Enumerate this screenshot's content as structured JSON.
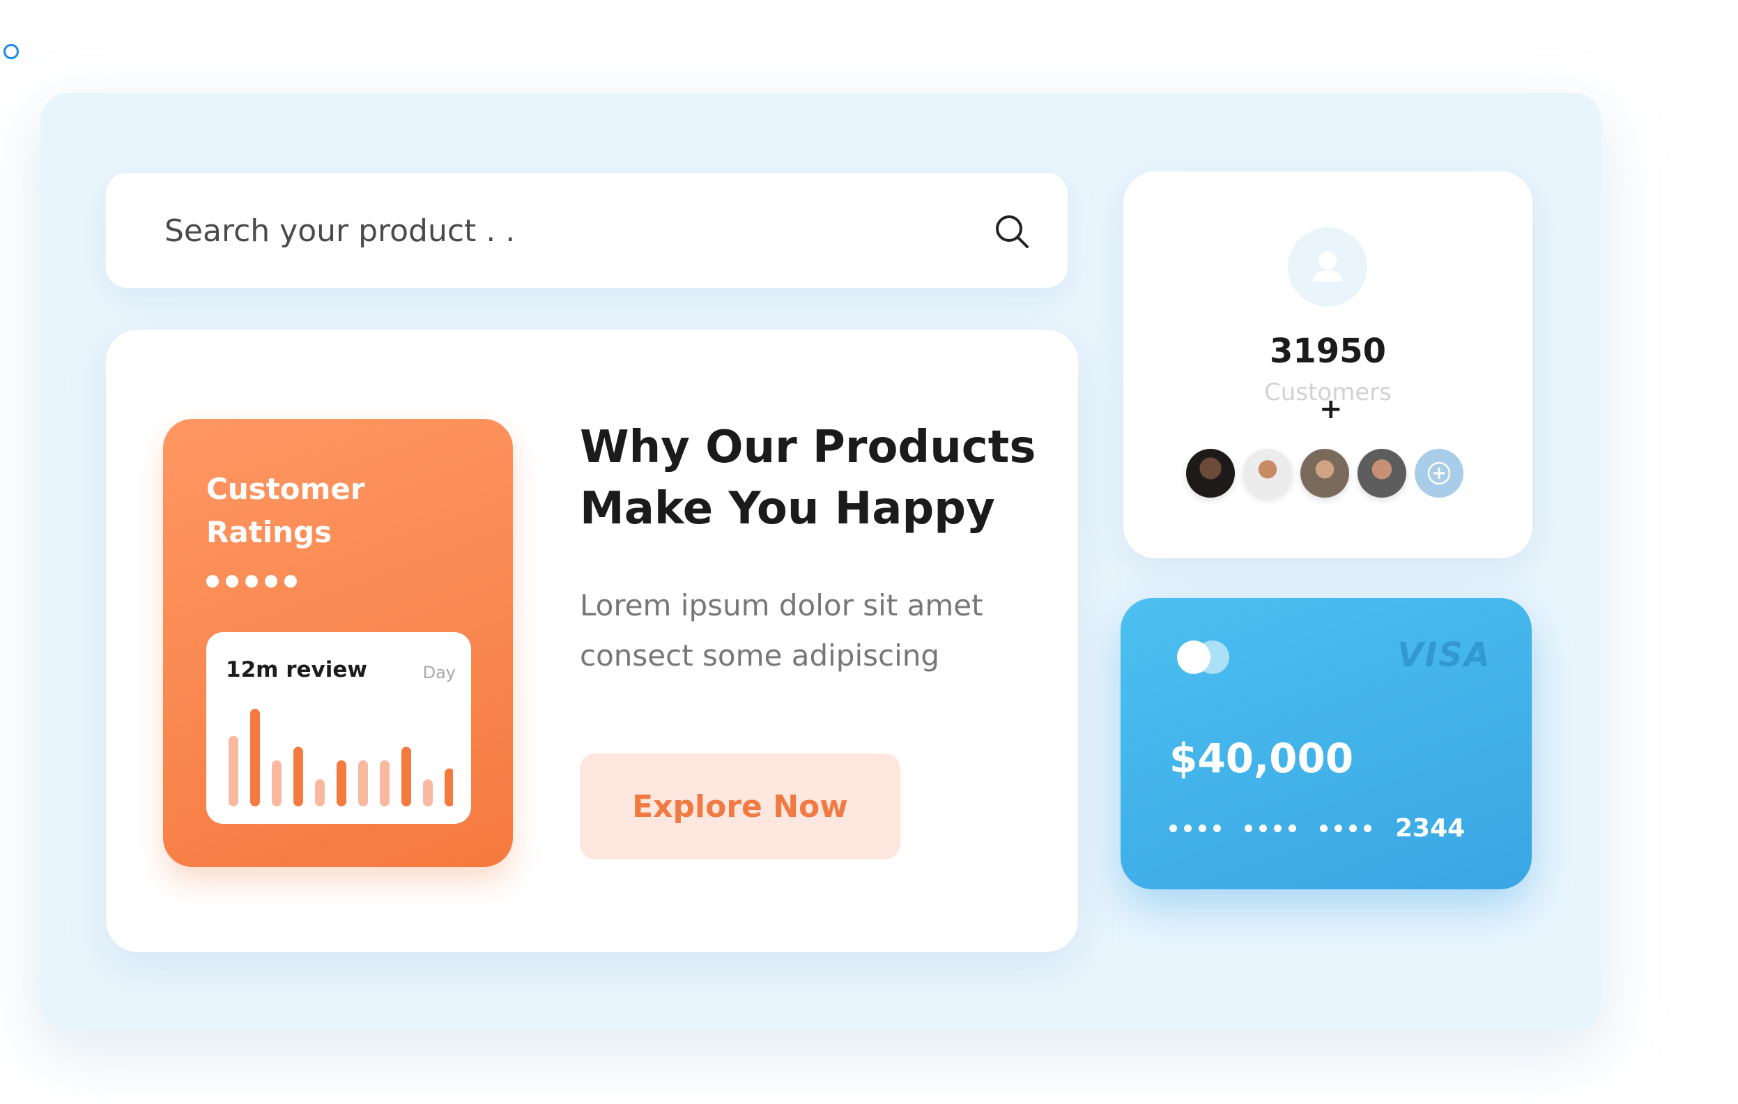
{
  "search": {
    "placeholder": "Search your product . .",
    "icon": "search-icon"
  },
  "ratings": {
    "title": "Customer Ratings",
    "stars_count": 5,
    "review_label": "12m review",
    "period_label": "Day",
    "chart_data": {
      "type": "bar",
      "values": [
        52,
        72,
        34,
        44,
        20,
        34,
        34,
        34,
        44,
        20,
        28
      ],
      "highlighted": [
        false,
        true,
        false,
        true,
        false,
        true,
        false,
        false,
        true,
        false,
        true
      ]
    }
  },
  "hero": {
    "headline": "Why Our Products Make You Happy",
    "description": "Lorem ipsum dolor sit amet consect  some adipiscing",
    "cta_label": "Explore Now"
  },
  "customers": {
    "count": "31950",
    "label": "Customers",
    "plus": "+"
  },
  "payment_card": {
    "brand": "VISA",
    "balance": "$40,000",
    "last4": "2344"
  },
  "colors": {
    "accent_orange": "#f57a40",
    "accent_blue": "#39a6e4",
    "frame_bg": "#e9f5fd"
  }
}
